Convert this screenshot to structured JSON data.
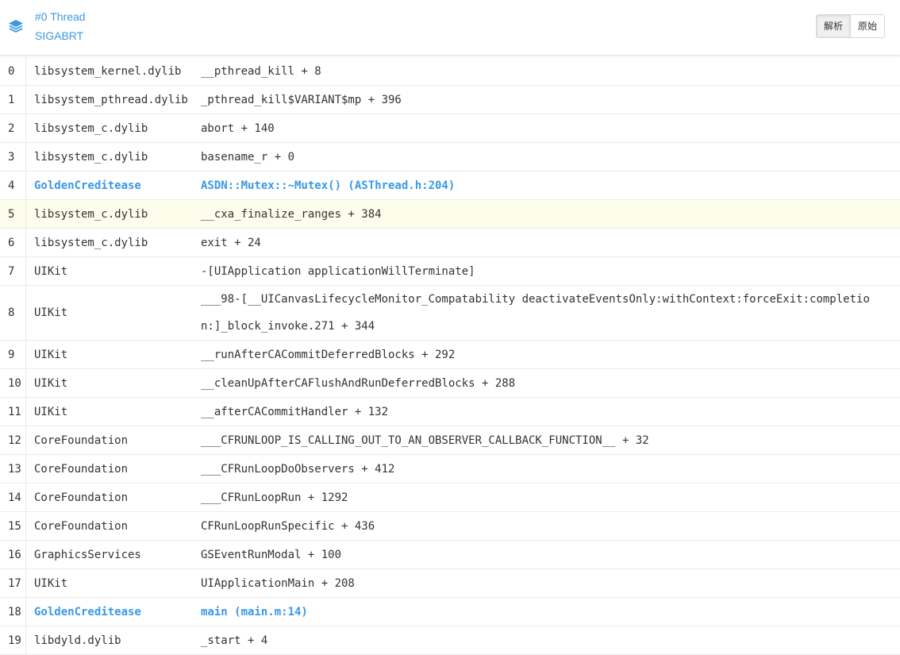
{
  "header": {
    "thread_name": "#0 Thread",
    "thread_signal": "SIGABRT",
    "icon": "layers-icon",
    "accent_color": "#3a98e6",
    "buttons": {
      "parsed_label": "解析",
      "raw_label": "原始",
      "active": "parsed"
    }
  },
  "frames": [
    {
      "index": "0",
      "module": "libsystem_kernel.dylib",
      "symbol": "__pthread_kill + 8",
      "app": false,
      "highlight": false
    },
    {
      "index": "1",
      "module": "libsystem_pthread.dylib",
      "symbol": "_pthread_kill$VARIANT$mp + 396",
      "app": false,
      "highlight": false
    },
    {
      "index": "2",
      "module": "libsystem_c.dylib",
      "symbol": "abort + 140",
      "app": false,
      "highlight": false
    },
    {
      "index": "3",
      "module": "libsystem_c.dylib",
      "symbol": "basename_r + 0",
      "app": false,
      "highlight": false
    },
    {
      "index": "4",
      "module": "GoldenCreditease",
      "symbol": "ASDN::Mutex::~Mutex() (ASThread.h:204)",
      "app": true,
      "highlight": false
    },
    {
      "index": "5",
      "module": "libsystem_c.dylib",
      "symbol": "__cxa_finalize_ranges + 384",
      "app": false,
      "highlight": true
    },
    {
      "index": "6",
      "module": "libsystem_c.dylib",
      "symbol": "exit + 24",
      "app": false,
      "highlight": false
    },
    {
      "index": "7",
      "module": "UIKit",
      "symbol": "-[UIApplication applicationWillTerminate]",
      "app": false,
      "highlight": false
    },
    {
      "index": "8",
      "module": "UIKit",
      "symbol": "___98-[__UICanvasLifecycleMonitor_Compatability deactivateEventsOnly:withContext:forceExit:completion:]_block_invoke.271 + 344",
      "app": false,
      "highlight": false,
      "wrap": true
    },
    {
      "index": "9",
      "module": "UIKit",
      "symbol": "__runAfterCACommitDeferredBlocks + 292",
      "app": false,
      "highlight": false
    },
    {
      "index": "10",
      "module": "UIKit",
      "symbol": "__cleanUpAfterCAFlushAndRunDeferredBlocks + 288",
      "app": false,
      "highlight": false
    },
    {
      "index": "11",
      "module": "UIKit",
      "symbol": "__afterCACommitHandler + 132",
      "app": false,
      "highlight": false
    },
    {
      "index": "12",
      "module": "CoreFoundation",
      "symbol": "___CFRUNLOOP_IS_CALLING_OUT_TO_AN_OBSERVER_CALLBACK_FUNCTION__ + 32",
      "app": false,
      "highlight": false
    },
    {
      "index": "13",
      "module": "CoreFoundation",
      "symbol": "___CFRunLoopDoObservers + 412",
      "app": false,
      "highlight": false
    },
    {
      "index": "14",
      "module": "CoreFoundation",
      "symbol": "___CFRunLoopRun + 1292",
      "app": false,
      "highlight": false
    },
    {
      "index": "15",
      "module": "CoreFoundation",
      "symbol": "CFRunLoopRunSpecific + 436",
      "app": false,
      "highlight": false
    },
    {
      "index": "16",
      "module": "GraphicsServices",
      "symbol": "GSEventRunModal + 100",
      "app": false,
      "highlight": false
    },
    {
      "index": "17",
      "module": "UIKit",
      "symbol": "UIApplicationMain + 208",
      "app": false,
      "highlight": false
    },
    {
      "index": "18",
      "module": "GoldenCreditease",
      "symbol": "main (main.m:14)",
      "app": true,
      "highlight": false
    },
    {
      "index": "19",
      "module": "libdyld.dylib",
      "symbol": "_start + 4",
      "app": false,
      "highlight": false
    }
  ]
}
